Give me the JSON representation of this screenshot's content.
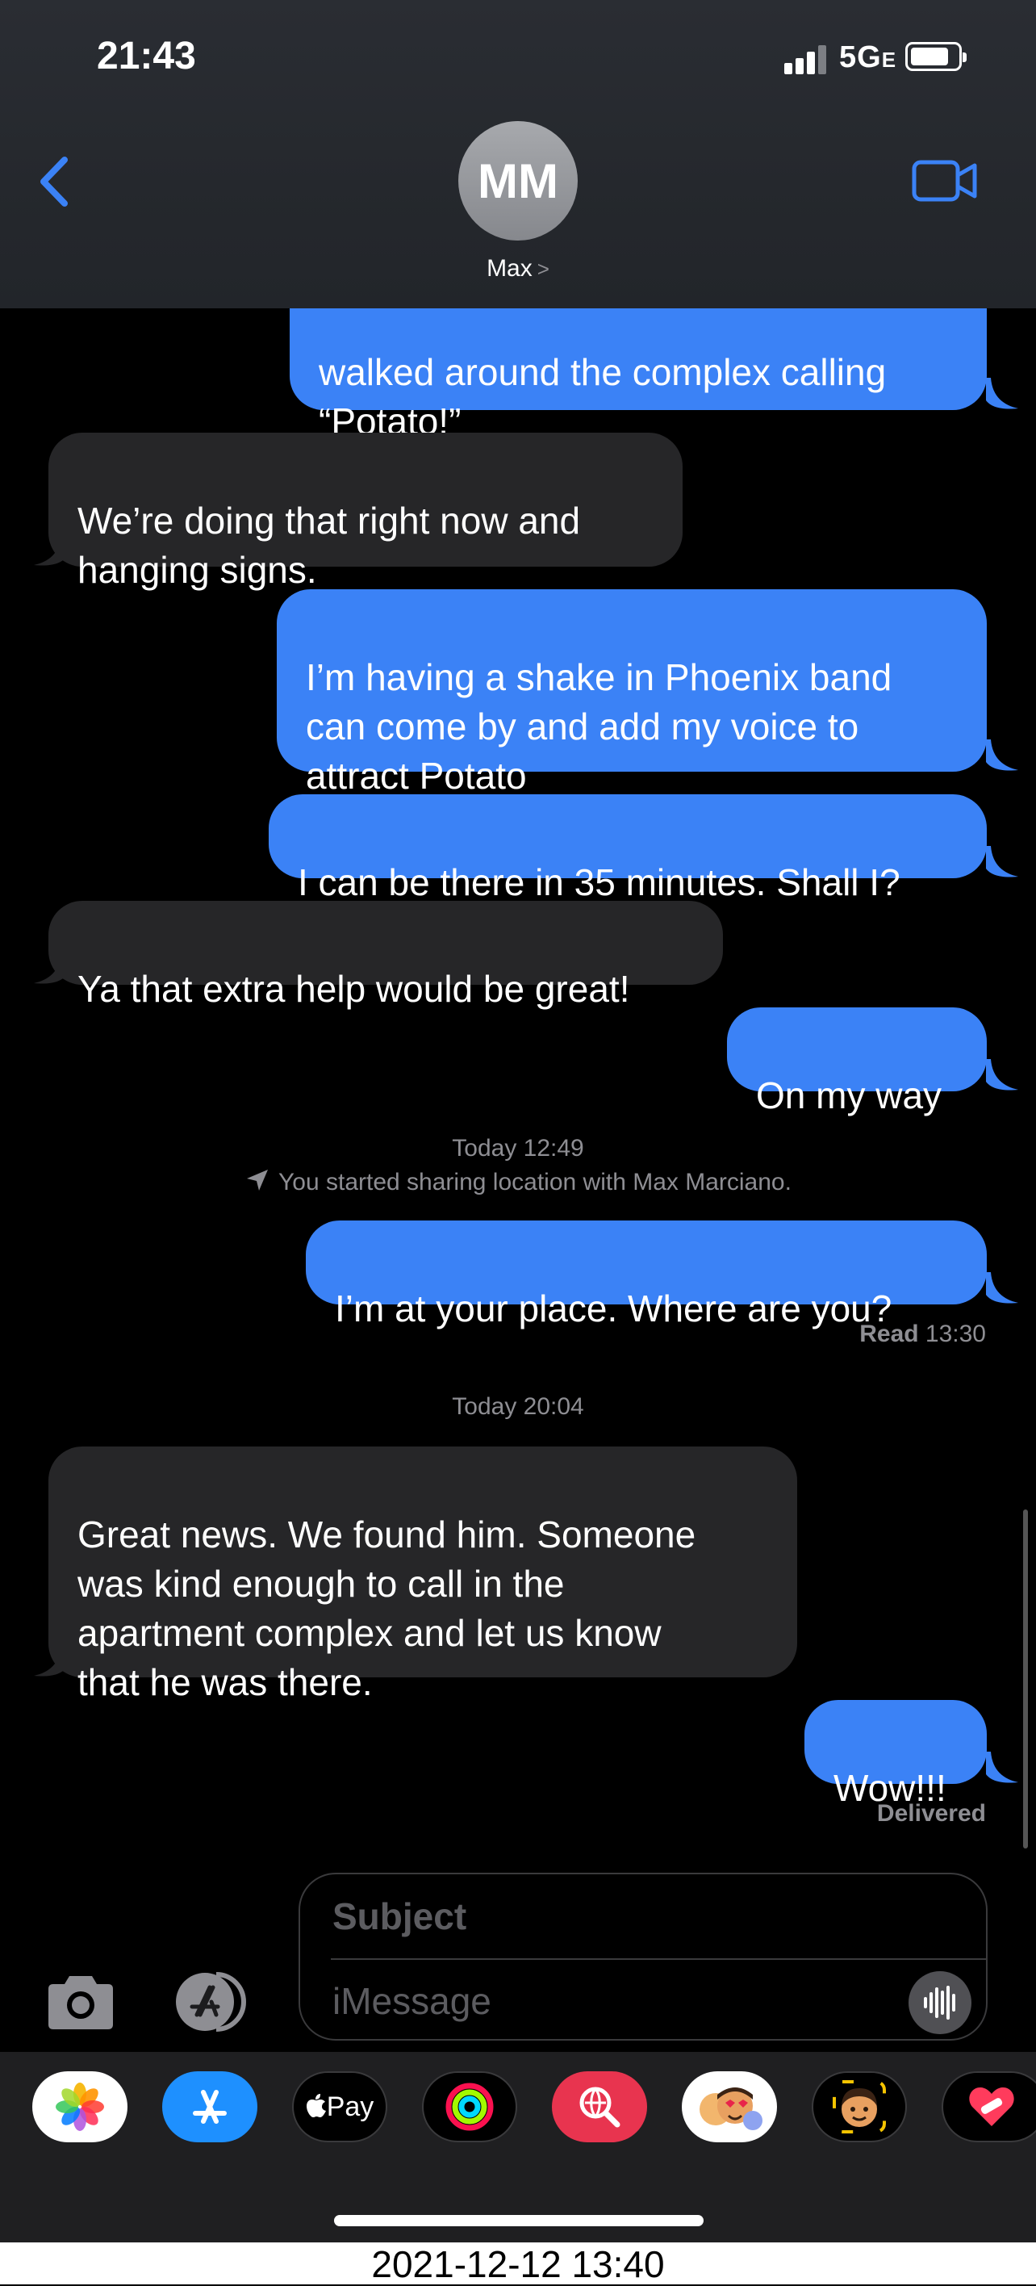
{
  "status_bar": {
    "time": "21:43",
    "network": "5G",
    "network_suffix": "E"
  },
  "header": {
    "avatar_initials": "MM",
    "contact_name": "Max",
    "chevron": ">"
  },
  "messages": [
    {
      "type": "sent",
      "text": "walked around the complex calling\n“Potato!”"
    },
    {
      "type": "received",
      "text": "We’re doing that right now and\nhanging signs."
    },
    {
      "type": "sent",
      "text": "I’m having a shake in Phoenix band\ncan come by and add my voice to\nattract Potato"
    },
    {
      "type": "sent",
      "text": "I can be there in 35 minutes. Shall I?"
    },
    {
      "type": "received",
      "text": "Ya that extra help would be great!"
    },
    {
      "type": "sent",
      "text": "On my way"
    },
    {
      "type": "sent",
      "text": "I’m at your place.  Where are you?"
    },
    {
      "type": "received",
      "text": "Great news. We found him. Someone\nwas kind enough to call in the\napartment complex and let us know\nthat he was there."
    },
    {
      "type": "sent",
      "text": "Wow!!!"
    }
  ],
  "timestamps": {
    "first": "Today 12:49",
    "second": "Today 20:04"
  },
  "location_notice": "You started sharing location with Max Marciano.",
  "read_receipt": {
    "label": "Read",
    "time": "13:30"
  },
  "delivered": "Delivered",
  "compose": {
    "subject_placeholder": "Subject",
    "message_placeholder": "iMessage"
  },
  "app_strip": [
    {
      "icon": "photos-icon"
    },
    {
      "icon": "app-store-icon"
    },
    {
      "icon": "apple-pay-icon",
      "label": "Pay"
    },
    {
      "icon": "activity-icon"
    },
    {
      "icon": "web-search-icon"
    },
    {
      "icon": "memoji-stickers-icon"
    },
    {
      "icon": "memoji-icon"
    },
    {
      "icon": "heart-stickers-icon"
    }
  ],
  "caption": "2021-12-12 13:40",
  "colors": {
    "sent_bubble": "#3b82f6",
    "received_bubble": "#262628",
    "accent": "#3b82f6"
  }
}
